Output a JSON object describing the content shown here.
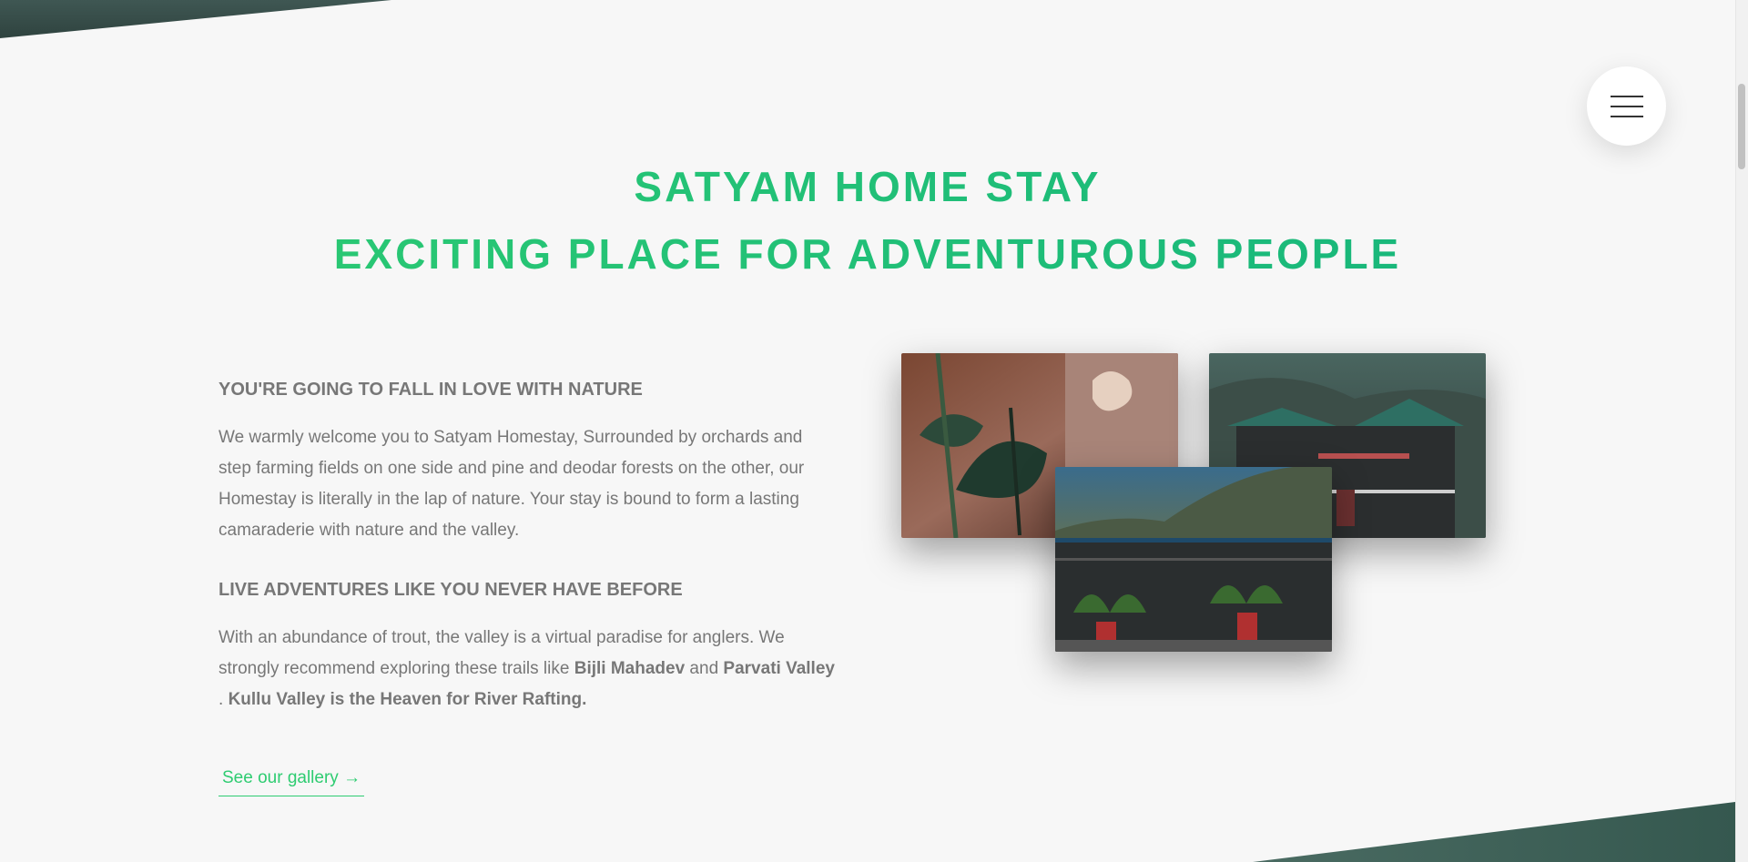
{
  "menu": {
    "icon": "hamburger-menu-icon"
  },
  "hero": {
    "title_line_1": "SATYAM HOME STAY",
    "title_line_2": "EXCITING PLACE FOR ADVENTUROUS PEOPLE"
  },
  "about": {
    "heading_1": "YOU'RE GOING TO FALL IN LOVE WITH NATURE",
    "paragraph_1": "We warmly welcome you to Satyam Homestay, Surrounded by orchards and step farming fields on one side and pine and deodar forests on the other, our Homestay is literally in the lap of nature. Your stay is bound to form a lasting camaraderie with nature and the valley.",
    "heading_2": "LIVE ADVENTURES LIKE YOU NEVER HAVE BEFORE",
    "paragraph_2_start": "With an abundance of trout, the valley is a virtual paradise for anglers. We strongly recommend exploring these trails like ",
    "paragraph_2_trail_1": "Bijli Mahadev",
    "paragraph_2_and": " and ",
    "paragraph_2_trail_2": "Parvati Valley",
    "paragraph_2_sep": " . ",
    "paragraph_2_end": "Kullu Valley is the Heaven for River Rafting.",
    "gallery_link": "See our gallery →"
  },
  "colors": {
    "accent_green": "#2ecc71",
    "accent_teal": "#14b37d",
    "text_grey": "#777777",
    "background": "#f7f7f7"
  }
}
